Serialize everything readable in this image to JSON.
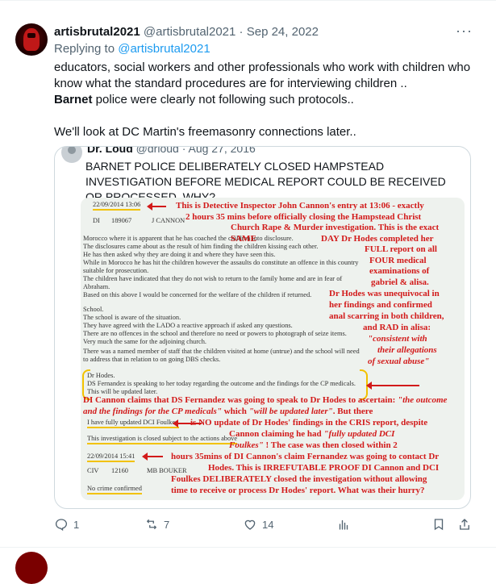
{
  "tweet": {
    "display_name": "artisbrutal2021",
    "handle": "@artisbrutal2021",
    "separator": "·",
    "date": "Sep 24, 2022",
    "more_label": "···",
    "replying_prefix": "Replying to",
    "replying_to": "@artisbrutal2021",
    "text_line1": "educators, social workers and other professionals who work with children who know what the standard procedures are for interviewing children  ..",
    "text_bold": "Barnet",
    "text_line2_rest": " police were clearly not following such protocols..",
    "text_line3": "We'll look at DC Martin's freemasonry connections later.."
  },
  "quoted": {
    "header_name": "Dr. Loud",
    "header_handle": "@drloud",
    "header_date": "· Aug 27, 2016",
    "text": "BARNET POLICE DELIBERATELY CLOSED HAMPSTEAD INVESTIGATION BEFORE MEDICAL REPORT COULD BE RECEIVED OR PROCESSED. WHY?",
    "document": {
      "entry_date": "22/09/2014 13:06",
      "entry_rank": "DI",
      "entry_number": "189067",
      "entry_name": "J CANNON",
      "lines": [
        "Morocco where it is apparent that he has coached the children into disclosure.",
        "The disclosures came about as the result of him finding the children kissing each other.",
        "He has then asked why they are doing it and where they have seen this.",
        "While in Morocco he has hit the children however the assaults do constitute an offence in this country",
        "suitable for prosecution.",
        "The children have indicated that they do not wish to return to the family home and are in fear of",
        "Abraham.",
        "Based on this above I would be concerned for the welfare of the children if returned.",
        "School.",
        "The school is aware of the situation.",
        "They have agreed with the LADO a reactive approach if asked any questions.",
        "There are no offences in the school and therefore no need or powers to photograph of seize items.",
        "Very much the same for the adjoining church.",
        "There was a named member of staff that the children visited at home (untrue) and the school will need",
        "to address that in relation to on going DBS checks."
      ],
      "hodes_lines": [
        "Dr Hodes.",
        "DS Fernandez is speaking to her today regarding the outcome and the findings for the CP medicals.",
        "This will be updated later."
      ],
      "updated_line": "I have fully updated DCI Foulkes.",
      "closed_line": "This investigation is closed subject to the actions above",
      "closing_date": "22/09/2014 15:41",
      "closing_rank": "CIV",
      "closing_number": "12160",
      "closing_name": "MB BOUKER",
      "no_crime": "No crime confirmed",
      "annotation_right": [
        "This is Detective Inspector John Cannon's entry at 13:06 - exactly",
        "2 hours 35 mins before officially closing the Hampstead Christ",
        "Church Rape & Murder investigation. This is the exact SAME",
        "DAY Dr Hodes completed her",
        "FULL report on all",
        "FOUR medical",
        "examinations of",
        "gabriel & alisa.",
        "Dr Hodes was unequivocal in",
        "her findings and confirmed",
        "anal scarring in both children,",
        "and RAD in alisa:",
        "\"consistent with",
        "their allegations",
        "of sexual abuse\""
      ],
      "annotation_mid_1": "DI Cannon claims that DS Fernandez was going to speak to Dr Hodes to ascertain: ",
      "annotation_mid_1_quote": "\"the outcome and the findings for the CP medicals\"",
      "annotation_mid_1_end": " which ",
      "annotation_mid_1_quote2": "\"will be updated later\"",
      "annotation_mid_1_tail": ". But there",
      "annotation_mid_2": "is NO update of Dr Hodes' findings in the CRIS report, despite",
      "annotation_mid_3": "Cannon claiming he had ",
      "annotation_mid_3_quote": "\"fully updated DCI",
      "annotation_mid_4_quote": "Foulkes\"",
      "annotation_mid_4": " ! The case was then closed within 2",
      "annotation_bottom": [
        "hours 35mins of DI Cannon's claim Fernandez was going to contact Dr",
        "Hodes. This is IRREFUTABLE PROOF DI Cannon and DCI",
        "Foulkes DELIBERATELY closed the investigation without allowing",
        "time to receive or process Dr Hodes' report. What was their hurry?"
      ]
    }
  },
  "actions": {
    "reply_count": "1",
    "retweet_count": "7",
    "like_count": "14"
  },
  "colors": {
    "accent": "#1d9bf0",
    "annotation_red": "#d21a1a",
    "highlight_yellow": "#f2c200"
  }
}
